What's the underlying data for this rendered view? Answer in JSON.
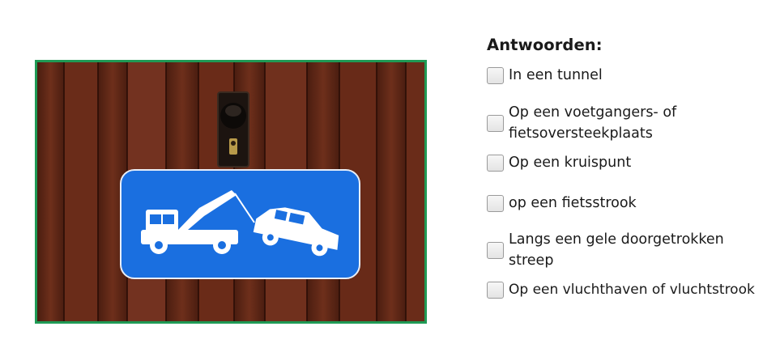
{
  "question": {
    "image_description_icon": "tow-away-zone-sign"
  },
  "answers": {
    "heading": "Antwoorden:",
    "options": [
      {
        "label": "In een tunnel",
        "checked": false
      },
      {
        "label": "Op een voetgangers- of fietsoversteekplaats",
        "checked": false
      },
      {
        "label": "Op een kruispunt",
        "checked": false
      },
      {
        "label": "op een fietsstrook",
        "checked": false
      },
      {
        "label": "Langs een gele doorgetrokken streep",
        "checked": false
      },
      {
        "label": "Op een vluchthaven of vluchtstrook",
        "checked": false
      }
    ]
  },
  "colors": {
    "image_border": "#1f9a55",
    "sign_blue": "#1a6fe0",
    "door_wood": "#6b2d1a"
  }
}
